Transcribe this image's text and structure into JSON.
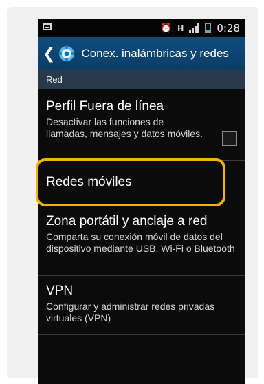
{
  "status_bar": {
    "time": "0:28",
    "icons": [
      "screenshot-icon",
      "alarm-icon",
      "network-h-icon",
      "signal-icon",
      "battery-icon"
    ],
    "network_label": "H"
  },
  "action_bar": {
    "back_icon": "back-chevron-icon",
    "app_icon": "settings-gear-icon",
    "title": "Conex. inalámbricas y redes"
  },
  "section_header": "Red",
  "items": [
    {
      "label": "Perfil Fuera de línea",
      "summary": "Desactivar las funciones de llamadas, mensajes y datos móviles.",
      "checked": false
    },
    {
      "label": "Redes móviles"
    },
    {
      "label": "Zona portátil y anclaje a red",
      "summary": "Comparta su conexión móvil de datos del dispositivo mediante USB, Wi-Fi o Bluetooth"
    },
    {
      "label": "VPN",
      "summary": "Configurar y administrar redes privadas virtuales (VPN)"
    }
  ],
  "colors": {
    "action_bar": "#0f4d7e",
    "section_header": "#2a3a4d",
    "highlight": "#f2b300",
    "battery_level": "#3cb4e6"
  }
}
